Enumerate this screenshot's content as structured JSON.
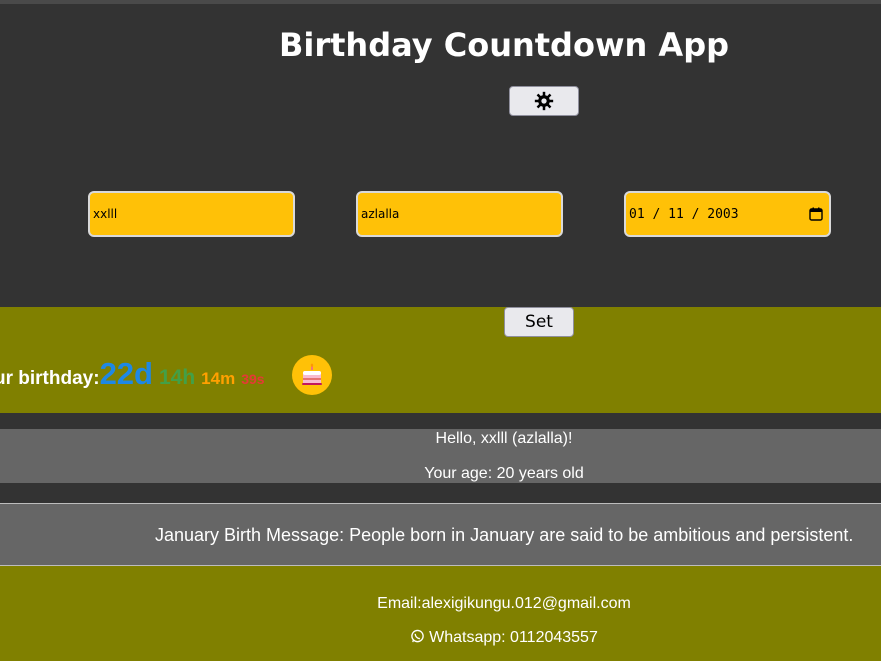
{
  "header": {
    "title": "Birthday Countdown App",
    "theme_toggle_icon": "gear-icon"
  },
  "form": {
    "name_value": "xxlll",
    "nickname_value": "azlalla",
    "date_value": "01 / 11 / 2003",
    "date_icon": "calendar-icon",
    "set_label": "Set"
  },
  "countdown": {
    "label": "ur birthday:",
    "days": "22d",
    "hours": "14h",
    "minutes": "14m",
    "seconds": "39s",
    "cake_icon": "cake-icon"
  },
  "greeting": {
    "hello": "Hello, xxlll (azlalla)!",
    "age": "Your age: 20 years old"
  },
  "birth_message": "January Birth Message: People born in January are said to be ambitious and persistent.",
  "footer": {
    "email": "Email:alexigikungu.012@gmail.com",
    "whatsapp": "Whatsapp: 0112043557",
    "whatsapp_icon": "whatsapp-icon"
  },
  "colors": {
    "background": "#333333",
    "input_fill": "#ffc107",
    "olive_band": "#808000",
    "gray_box": "#666666",
    "days": "#1e88e5",
    "hours": "#43a047",
    "minutes": "#ffa000",
    "seconds": "#e53935"
  }
}
